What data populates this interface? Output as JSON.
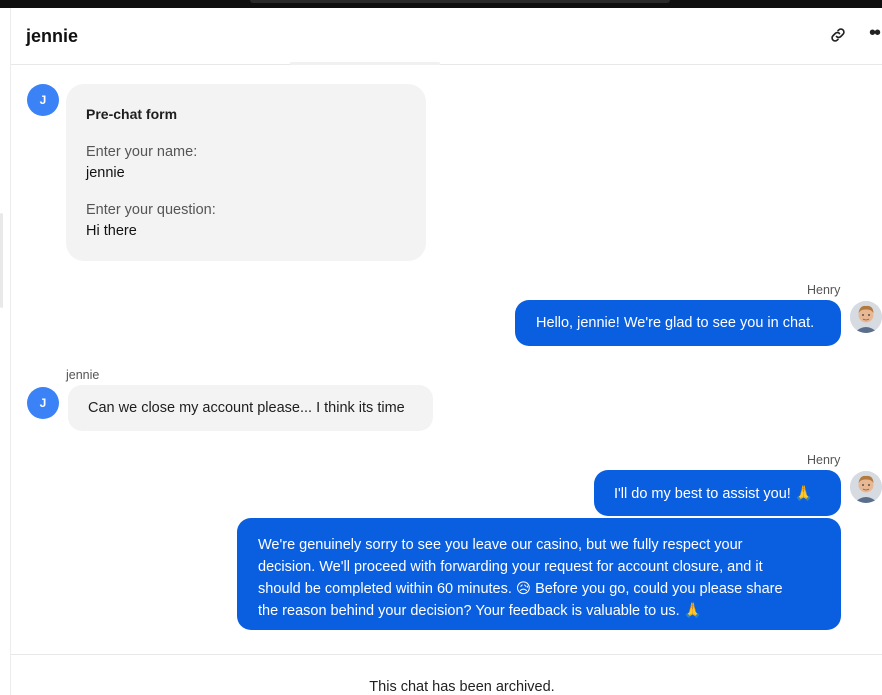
{
  "header": {
    "title": "jennie",
    "link_icon": "link-icon",
    "more_icon": "more-options-icon"
  },
  "messages": [
    {
      "type": "prechat_form",
      "avatar_initial": "J",
      "form_title": "Pre-chat form",
      "fields": [
        {
          "label": "Enter your name:",
          "value": "jennie"
        },
        {
          "label": "Enter your question:",
          "value": "Hi there"
        }
      ]
    },
    {
      "type": "agent",
      "sender": "Henry",
      "text": "Hello, jennie! We're glad to see you in chat."
    },
    {
      "type": "visitor",
      "sender": "jennie",
      "avatar_initial": "J",
      "text": "Can we close my account please... I think its time"
    },
    {
      "type": "agent",
      "sender": "Henry",
      "text": "I'll do my best to assist you! 🙏"
    },
    {
      "type": "agent_continuation",
      "lines": [
        "We're genuinely sorry to see you leave our casino, but we fully respect your",
        "decision. We'll proceed with forwarding your request for account closure, and it",
        "should be completed within 60 minutes. 😥 Before you go, could you please share",
        "the reason behind your decision? Your feedback is valuable to us. 🙏"
      ]
    }
  ],
  "footer": {
    "archived_text": "This chat has been archived."
  },
  "colors": {
    "agent_bubble": "#0a5fe0",
    "visitor_bubble": "#f3f3f3",
    "avatar": "#3b82f6"
  }
}
